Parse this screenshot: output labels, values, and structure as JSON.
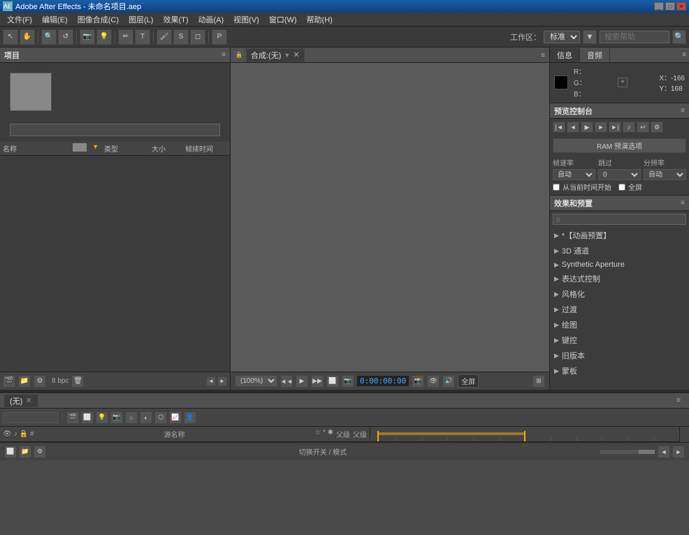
{
  "titleBar": {
    "title": "Adobe After Effects - 未命名项目.aep",
    "icon": "AE"
  },
  "menuBar": {
    "items": [
      {
        "label": "文件(F)"
      },
      {
        "label": "编辑(E)"
      },
      {
        "label": "图像合成(C)"
      },
      {
        "label": "图层(L)"
      },
      {
        "label": "效果(T)"
      },
      {
        "label": "动画(A)"
      },
      {
        "label": "视图(V)"
      },
      {
        "label": "窗口(W)"
      },
      {
        "label": "帮助(H)"
      }
    ]
  },
  "toolbar": {
    "workspaceLabel": "工作区：",
    "workspaceValue": "标准",
    "searchPlaceholder": "搜索帮助"
  },
  "projectPanel": {
    "title": "项目",
    "searchPlaceholder": "",
    "columns": {
      "name": "名称",
      "type": "类型",
      "size": "大小",
      "duration": "帧续时间"
    },
    "bpc": "8 bpc"
  },
  "compositionPanel": {
    "title": "合成:(无)",
    "zoom": "(100%)",
    "timecode": "0:00:00:00",
    "fullscreen": "全屏"
  },
  "infoPanel": {
    "tabs": [
      "信息",
      "音频"
    ],
    "r": "R：",
    "g": "G：",
    "b": "B：",
    "x": "X：-166",
    "y": "Y：168"
  },
  "previewPanel": {
    "title": "预览控制台",
    "ramBtn": "RAM 预演选项",
    "options": {
      "speed": {
        "label": "帧速率",
        "value": "自动"
      },
      "skip": {
        "label": "跳过",
        "value": "0"
      },
      "resolution": {
        "label": "分辨率",
        "value": "自动"
      },
      "fromCurrentTime": "从当前时间开始",
      "fullScreen": "全屏"
    }
  },
  "effectsPanel": {
    "title": "效果和预置",
    "searchPlaceholder": "p",
    "items": [
      {
        "label": "*【动画预置】"
      },
      {
        "label": "3D 通道"
      },
      {
        "label": "Synthetic Aperture"
      },
      {
        "label": "表达式控制"
      },
      {
        "label": "风格化"
      },
      {
        "label": "过渡"
      },
      {
        "label": "绘图"
      },
      {
        "label": "键控"
      },
      {
        "label": "旧版本"
      },
      {
        "label": "蒙板"
      }
    ]
  },
  "timelinePanel": {
    "title": "(无)",
    "layerColumns": {
      "icons": [
        "眼",
        "#",
        "锁"
      ],
      "name": "源名称",
      "others": [
        "父级",
        "父级"
      ]
    },
    "footer": {
      "switchLabel": "切换开关 / 模式"
    }
  }
}
